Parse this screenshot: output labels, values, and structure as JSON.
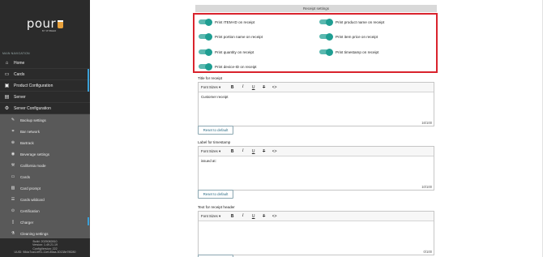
{
  "sidebar": {
    "logo_word": "pour",
    "logo_sub": "BY MYBEER",
    "section_label": "MAIN NAVIGATION",
    "items": [
      {
        "label": "Home",
        "icon": "home-icon",
        "glyph": "⌂"
      },
      {
        "label": "Cards",
        "icon": "card-icon",
        "glyph": "▭"
      },
      {
        "label": "Product Configuration",
        "icon": "product-icon",
        "glyph": "▣"
      },
      {
        "label": "Server",
        "icon": "server-icon",
        "glyph": "▤"
      },
      {
        "label": "Server Configuration",
        "icon": "gear-icon",
        "glyph": "⚙"
      }
    ],
    "sub_items": [
      {
        "label": "Backup settings",
        "icon": "wrench-icon",
        "glyph": "✎"
      },
      {
        "label": "Bar network",
        "icon": "network-icon",
        "glyph": "⌗"
      },
      {
        "label": "Bartrack",
        "icon": "bartrack-icon",
        "glyph": "⊕"
      },
      {
        "label": "Beverage settings",
        "icon": "beverage-icon",
        "glyph": "◉"
      },
      {
        "label": "California mode",
        "icon": "hammer-icon",
        "glyph": "⚒"
      },
      {
        "label": "Cards",
        "icon": "card-icon",
        "glyph": "▭"
      },
      {
        "label": "Card prompt",
        "icon": "prompt-icon",
        "glyph": "▨"
      },
      {
        "label": "Cards wildcard",
        "icon": "list-icon",
        "glyph": "☰"
      },
      {
        "label": "Certification",
        "icon": "certification-icon",
        "glyph": "⊙"
      },
      {
        "label": "Charger",
        "icon": "charger-icon",
        "glyph": "▯"
      },
      {
        "label": "Cleaning settings",
        "icon": "cleaning-icon",
        "glyph": "⚗"
      }
    ],
    "build": {
      "line1": "Build: 2025082810",
      "line2": "Version: 1.49.21.19",
      "line3": "ConfigVersion: 222",
      "line4": "UUID: 98da7ca4-bf91-11ef-85aa-30138e7f8280"
    }
  },
  "receipt": {
    "heading": "Receipt settings",
    "toggles": [
      {
        "label": "Print ITEM-ID on receipt",
        "on": true
      },
      {
        "label": "Print product name on receipt",
        "on": true
      },
      {
        "label": "Print portion name on receipt",
        "on": true
      },
      {
        "label": "Print item price on receipt",
        "on": true
      },
      {
        "label": "Print quantity on receipt",
        "on": true
      },
      {
        "label": "Print timestamp on receipt",
        "on": true
      },
      {
        "label": "Print device-ID on receipt",
        "on": true
      }
    ],
    "toggle_color": "#1f9e92",
    "highlight_color": "#d9232d"
  },
  "editors": [
    {
      "label": "Title for receipt",
      "font_sizes": "Font Sizes ▾",
      "content": "Customer receipt",
      "counter": "16/100",
      "reset": "Reset to default"
    },
    {
      "label": "Label for timestamp",
      "font_sizes": "Font Sizes ▾",
      "content": "issued at:",
      "counter": "10/100",
      "reset": "Reset to default"
    },
    {
      "label": "Text for receipt header",
      "font_sizes": "Font Sizes ▾",
      "content": "",
      "counter": "0/100",
      "reset": "Reset to default"
    }
  ],
  "toolbar": {
    "bold": "B",
    "italic": "I",
    "underline": "U",
    "clear": "T",
    "code": "<>"
  }
}
